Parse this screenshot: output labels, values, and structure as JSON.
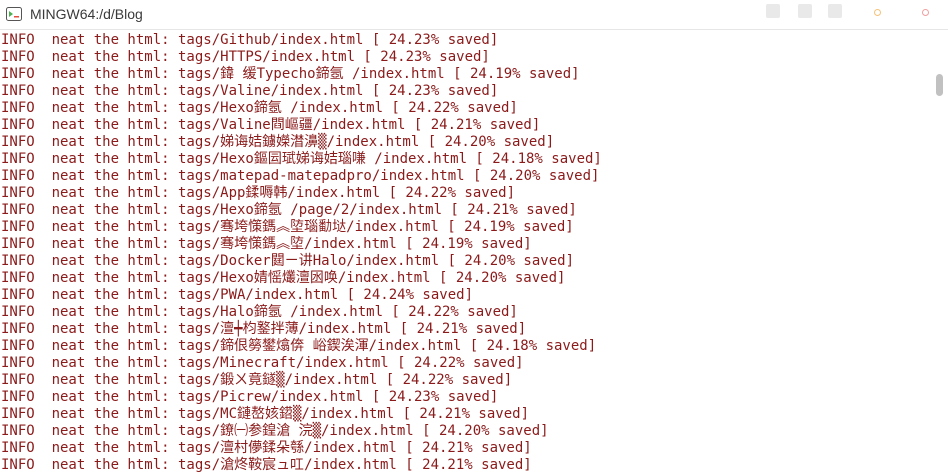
{
  "window": {
    "title": "MINGW64:/d/Blog"
  },
  "colors": {
    "terminal_text": "#8b1a1a",
    "background": "#ffffff",
    "close_button": "#f0a0a0",
    "minimize_button": "#f5c27a"
  },
  "icons": {
    "app": "git-bash-icon",
    "close": "close-dot",
    "maximize": "maximize-dot",
    "minimize": "minimize-dot"
  },
  "terminal": {
    "lines": [
      "INFO  neat the html: tags/Github/index.html [ 24.23% saved]",
      "INFO  neat the html: tags/HTTPS/index.html [ 24.23% saved]",
      "INFO  neat the html: tags/鍏 缓Typecho鍗氬 /index.html [ 24.19% saved]",
      "INFO  neat the html: tags/Valine/index.html [ 24.23% saved]",
      "INFO  neat the html: tags/Hexo鍗氬 /index.html [ 24.22% saved]",
      "INFO  neat the html: tags/Valine閰嶇疆/index.html [ 24.21% saved]",
      "INFO  neat the html: tags/娣诲姞鐪嬫澘濞▒/index.html [ 24.20% saved]",
      "INFO  neat the html: tags/Hexo鏂囩珷娣诲姞瑙嗛 /index.html [ 24.18% saved]",
      "INFO  neat the html: tags/matepad-matepadpro/index.html [ 24.20% saved]",
      "INFO  neat the html: tags/App鍒嗕韩/index.html [ 24.22% saved]",
      "INFO  neat the html: tags/Hexo鍗氬 /page/2/index.html [ 24.21% saved]",
      "INFO  neat the html: tags/骞垮憡鎷︽埅瑙勫垯/index.html [ 24.19% saved]",
      "INFO  neat the html: tags/骞垮憡鎷︽埅/index.html [ 24.19% saved]",
      "INFO  neat the html: tags/Docker閮ㄧ讲Halo/index.html [ 24.20% saved]",
      "INFO  neat the html: tags/Hexo婧愮爜澶囦唤/index.html [ 24.20% saved]",
      "INFO  neat the html: tags/PWA/index.html [ 24.24% saved]",
      "INFO  neat the html: tags/Halo鍗氬 /index.html [ 24.22% saved]",
      "INFO  neat the html: tags/澶┿枃鐜拌薄/index.html [ 24.21% saved]",
      "INFO  neat the html: tags/鍗佷簩鐢熻倴 峪鍥涘渾/index.html [ 24.18% saved]",
      "INFO  neat the html: tags/Minecraft/index.html [ 24.22% saved]",
      "INFO  neat the html: tags/鍛ㄨ竟鐩▒/index.html [ 24.22% saved]",
      "INFO  neat the html: tags/Picrew/index.html [ 24.23% saved]",
      "INFO  neat the html: tags/MC鏈嶅姟鍣▒/index.html [ 24.21% saved]",
      "INFO  neat the html: tags/鐐㈠参鍠滄 浣▒/index.html [ 24.20% saved]",
      "INFO  neat the html: tags/澶村儚鍒朵綔/index.html [ 24.21% saved]",
      "INFO  neat the html: tags/滄炵鞍宸ュ叿/index.html [ 24.21% saved]"
    ]
  }
}
